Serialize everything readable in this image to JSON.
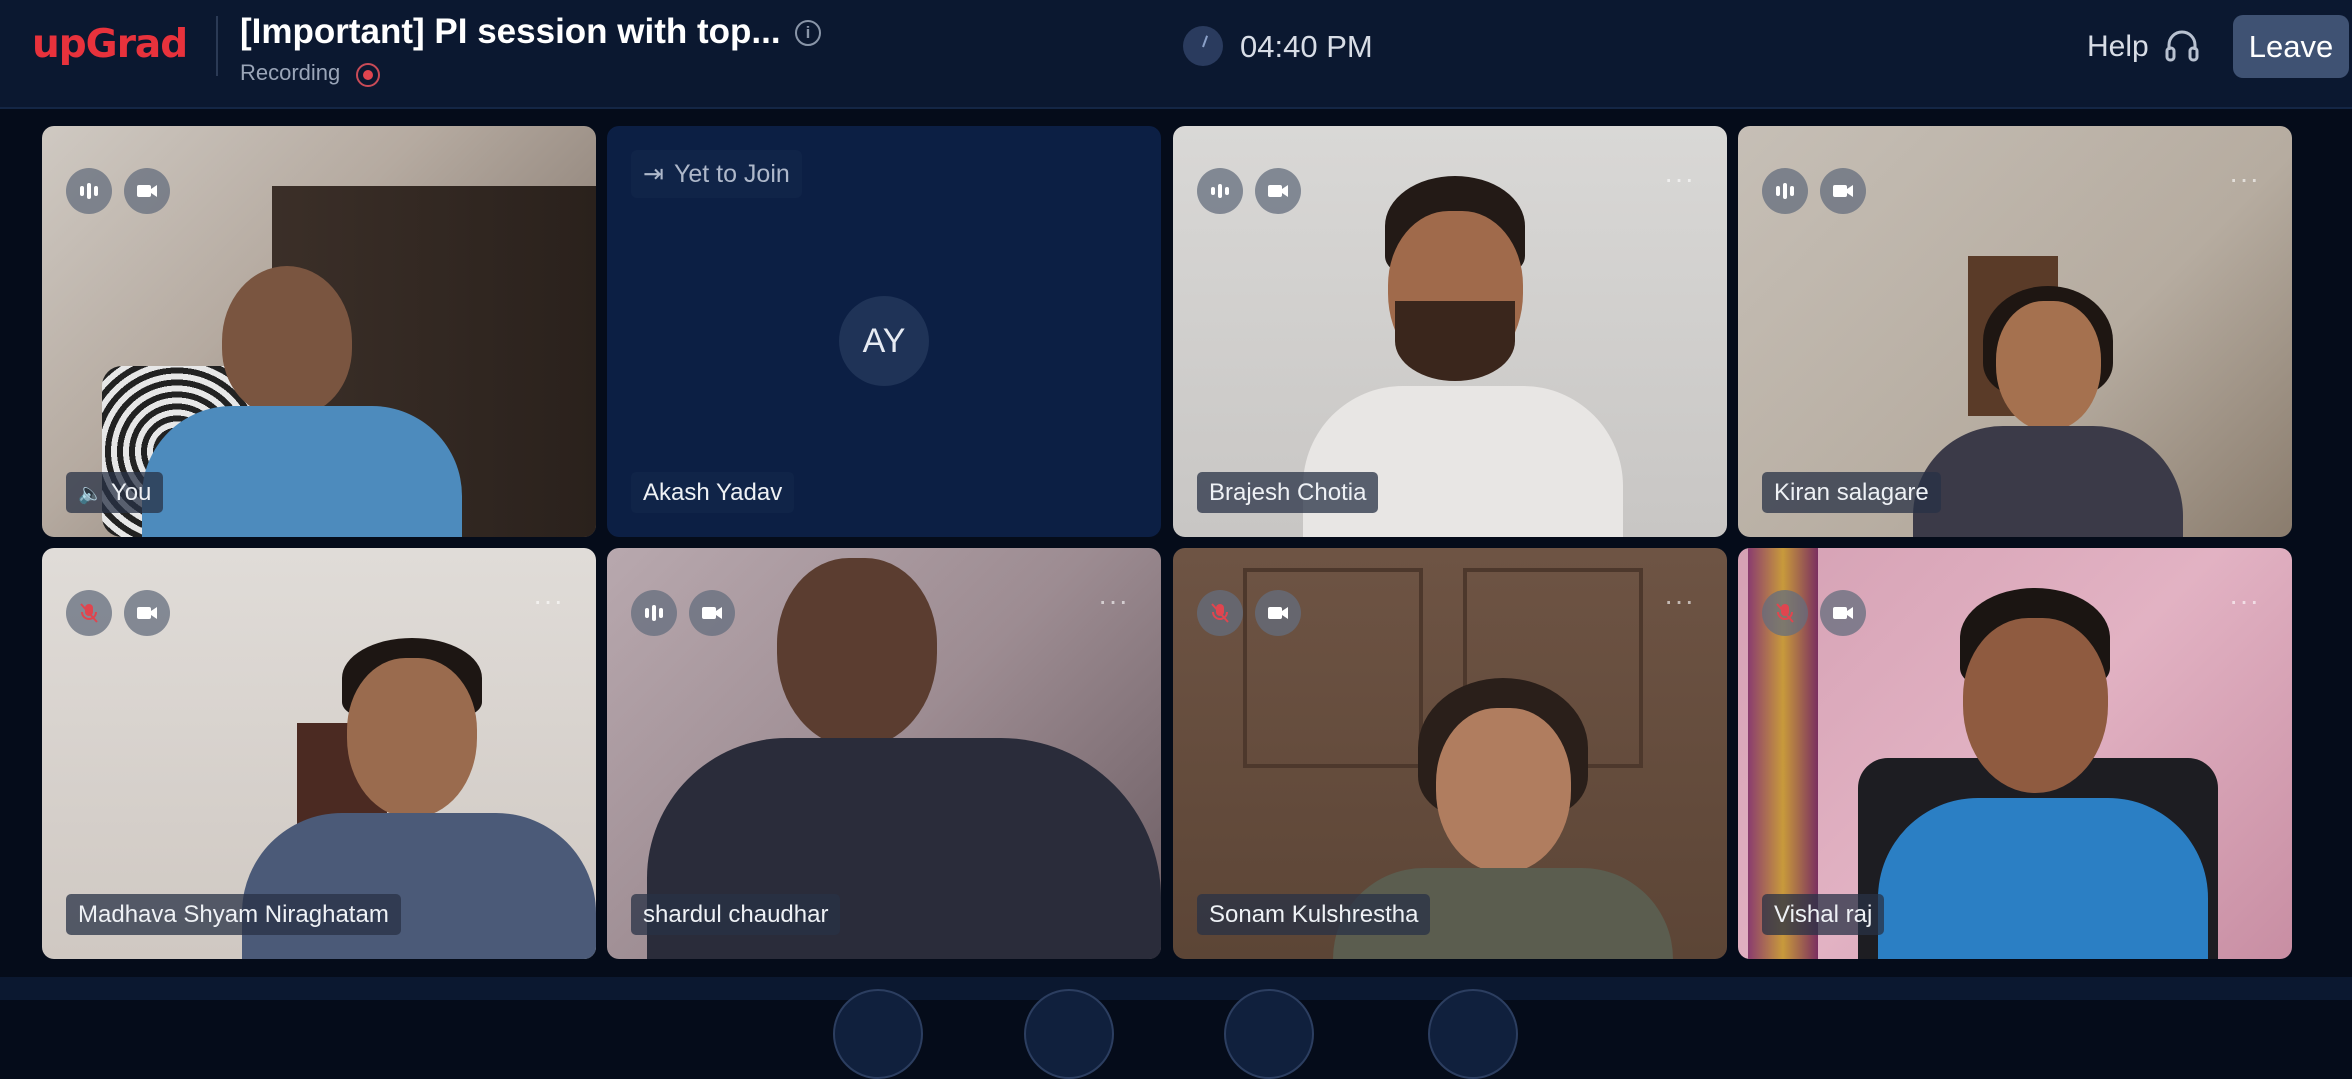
{
  "header": {
    "logo": "upGrad",
    "title": "[Important] PI session with top...",
    "recording_label": "Recording",
    "time": "04:40 PM",
    "help_label": "Help",
    "leave_label": "Leave"
  },
  "participants": [
    {
      "name": "You",
      "state": "speaking"
    },
    {
      "name": "Akash Yadav",
      "initials": "AY",
      "status": "Yet to Join"
    },
    {
      "name": "Brajesh Chotia"
    },
    {
      "name": "Kiran salagare"
    },
    {
      "name": "Madhava Shyam Niraghatam",
      "mic": "muted"
    },
    {
      "name": "shardul chaudhar"
    },
    {
      "name": "Sonam Kulshrestha",
      "mic": "muted"
    },
    {
      "name": "Vishal raj",
      "mic": "muted"
    }
  ],
  "colors": {
    "brand": "#e8323c",
    "topbar": "#0b1830",
    "muted_mic": "#e0454f",
    "leave_button": "#3f5273"
  },
  "icons": [
    "info-icon",
    "recording-icon",
    "clock-icon",
    "headset-icon",
    "audio-level-icon",
    "camera-icon",
    "mic-muted-icon",
    "more-options-icon",
    "exit-icon"
  ]
}
